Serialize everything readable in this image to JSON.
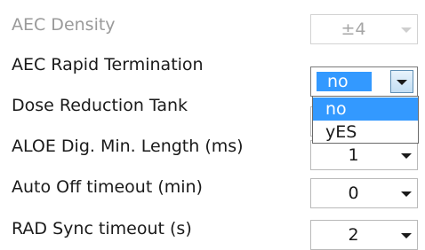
{
  "settings": [
    {
      "label": "AEC Density",
      "value": "±4",
      "disabled": true
    },
    {
      "label": "AEC Rapid Termination",
      "value": "no",
      "open": true
    },
    {
      "label": "Dose Reduction Tank",
      "value": ""
    },
    {
      "label": "ALOE Dig. Min. Length (ms)",
      "value": "1"
    },
    {
      "label": "Auto Off timeout (min)",
      "value": "0"
    },
    {
      "label": "RAD Sync timeout (s)",
      "value": "2"
    }
  ],
  "dropdown": {
    "options": [
      "no",
      "yES"
    ],
    "selected": "no"
  },
  "colors": {
    "highlight": "#3399ff",
    "disabled_text": "#9a9a9a"
  }
}
